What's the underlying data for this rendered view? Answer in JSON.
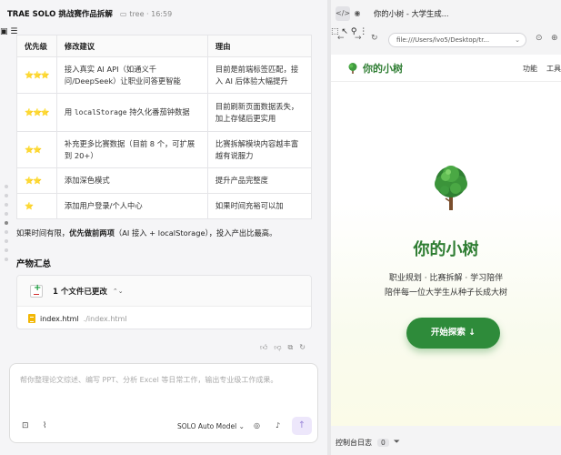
{
  "left": {
    "header": {
      "title": "TRAE SOLO 挑战赛作品拆解",
      "branch": "tree · 16:59"
    },
    "table": {
      "headers": [
        "优先级",
        "修改建议",
        "理由"
      ],
      "rows": [
        {
          "priority": "⭐⭐⭐",
          "suggestion": "接入真实 AI API（如通义千问/DeepSeek）让职业问答更智能",
          "reason": "目前是前端标签匹配，接入 AI 后体验大幅提升"
        },
        {
          "priority": "⭐⭐⭐",
          "suggestion_pre": "用 ",
          "suggestion_code": "localStorage",
          "suggestion_post": " 持久化番茄钟数据",
          "reason": "目前刷新页面数据丢失，加上存储后更实用"
        },
        {
          "priority": "⭐⭐",
          "suggestion": "补充更多比赛数据（目前 8 个，可扩展到 20+）",
          "reason": "比赛拆解模块内容越丰富越有说服力"
        },
        {
          "priority": "⭐⭐",
          "suggestion": "添加深色模式",
          "reason": "提升产品完整度"
        },
        {
          "priority": "⭐",
          "suggestion": "添加用户登录/个人中心",
          "reason": "如果时间充裕可以加"
        }
      ]
    },
    "note": {
      "pre": "如果时间有限，",
      "bold": "优先做前两项",
      "post": "（AI 接入 + localStorage），投入产出比最高。"
    },
    "section_title": "产物汇总",
    "files": {
      "summary": "1 个文件已更改",
      "file_name": "index.html",
      "file_path": "./index.html"
    },
    "composer": {
      "placeholder": "帮你整理论文综述、编写 PPT、分析 Excel 等日常工作，输出专业级工作成果。",
      "model": "SOLO Auto Model"
    }
  },
  "right": {
    "tab_title": "你的小树 - 大学生成...",
    "url": "file:///Users/lvo5/Desktop/tr...",
    "site": {
      "brand": "你的小树",
      "nav": [
        "功能",
        "工具"
      ],
      "hero_title": "你的小树",
      "hero_sub1": "职业规划 · 比赛拆解 · 学习陪伴",
      "hero_sub2": "陪伴每一位大学生从种子长成大树",
      "cta": "开始探索  ↓"
    },
    "console": {
      "label": "控制台日志",
      "count": "0"
    }
  },
  "colors": {
    "accent_green": "#2e8b3a",
    "star": "#e8a600",
    "send_bg": "#ede7fb"
  }
}
